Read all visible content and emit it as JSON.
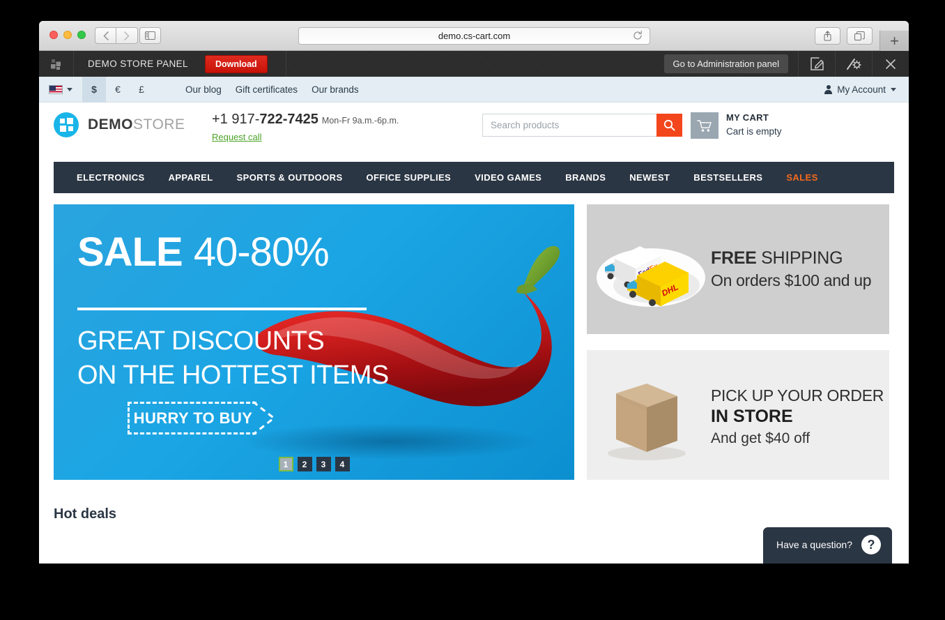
{
  "browser": {
    "url": "demo.cs-cart.com",
    "back_icon": "chevron-left-icon",
    "forward_icon": "chevron-right-icon",
    "sidebar_icon": "sidebar-toggle-icon",
    "reload_icon": "reload-icon",
    "share_icon": "share-icon",
    "tabs_icon": "show-tabs-icon",
    "newtab_label": "+"
  },
  "admin_bar": {
    "grid_icon": "grid-icon",
    "title": "DEMO STORE PANEL",
    "download_label": "Download",
    "go_admin_label": "Go to Administration panel",
    "edit_icon": "edit-icon",
    "tools_icon": "wand-gear-icon",
    "close_icon": "close-icon"
  },
  "topbar": {
    "flag_icon": "us-flag-icon",
    "currencies": [
      {
        "symbol": "$",
        "active": true
      },
      {
        "symbol": "€",
        "active": false
      },
      {
        "symbol": "£",
        "active": false
      }
    ],
    "links": [
      "Our blog",
      "Gift certificates",
      "Our brands"
    ],
    "account_label": "My Account",
    "account_icon": "person-icon"
  },
  "header": {
    "logo_name_bold": "DEMO",
    "logo_name_light": "STORE",
    "phone_prefix": "+1 917-",
    "phone_main": "722-7425",
    "hours": "Mon-Fr 9a.m.-6p.m.",
    "request_call": "Request call",
    "search_placeholder": "Search products",
    "search_value": "",
    "search_icon": "search-icon",
    "cart_icon": "cart-icon",
    "cart_title": "MY CART",
    "cart_status": "Cart is empty"
  },
  "mainnav": {
    "items": [
      {
        "label": "ELECTRONICS",
        "highlight": false
      },
      {
        "label": "APPAREL",
        "highlight": false
      },
      {
        "label": "SPORTS & OUTDOORS",
        "highlight": false
      },
      {
        "label": "OFFICE SUPPLIES",
        "highlight": false
      },
      {
        "label": "VIDEO GAMES",
        "highlight": false
      },
      {
        "label": "BRANDS",
        "highlight": false
      },
      {
        "label": "NEWEST",
        "highlight": false
      },
      {
        "label": "BESTSELLERS",
        "highlight": false
      },
      {
        "label": "SALES",
        "highlight": true
      }
    ]
  },
  "hero": {
    "title_bold": "SALE",
    "title_light": "40-80%",
    "subtitle_line1": "GREAT DISCOUNTS",
    "subtitle_line2": "ON THE HOTTEST ITEMS",
    "cta_label": "HURRY TO BUY",
    "image": "red-chili-pepper-image",
    "pagination": [
      "1",
      "2",
      "3",
      "4"
    ],
    "active_page": "1"
  },
  "promos": [
    {
      "icon": "delivery-trucks-image",
      "title_bold": "FREE",
      "title_light": "SHIPPING",
      "subtitle": "On orders $100 and up"
    },
    {
      "icon": "cardboard-box-image",
      "title_light": "PICK UP YOUR ORDER",
      "title_bold": "IN STORE",
      "subtitle": "And get $40 off"
    }
  ],
  "section": {
    "hot_deals_title": "Hot deals"
  },
  "chat": {
    "label": "Have a question?",
    "badge": "?"
  },
  "colors": {
    "accent_orange": "#f4461c",
    "nav_dark": "#2b3644",
    "hero_blue": "#1ba5e4",
    "download_red": "#d01a10",
    "link_green": "#4aa327"
  }
}
